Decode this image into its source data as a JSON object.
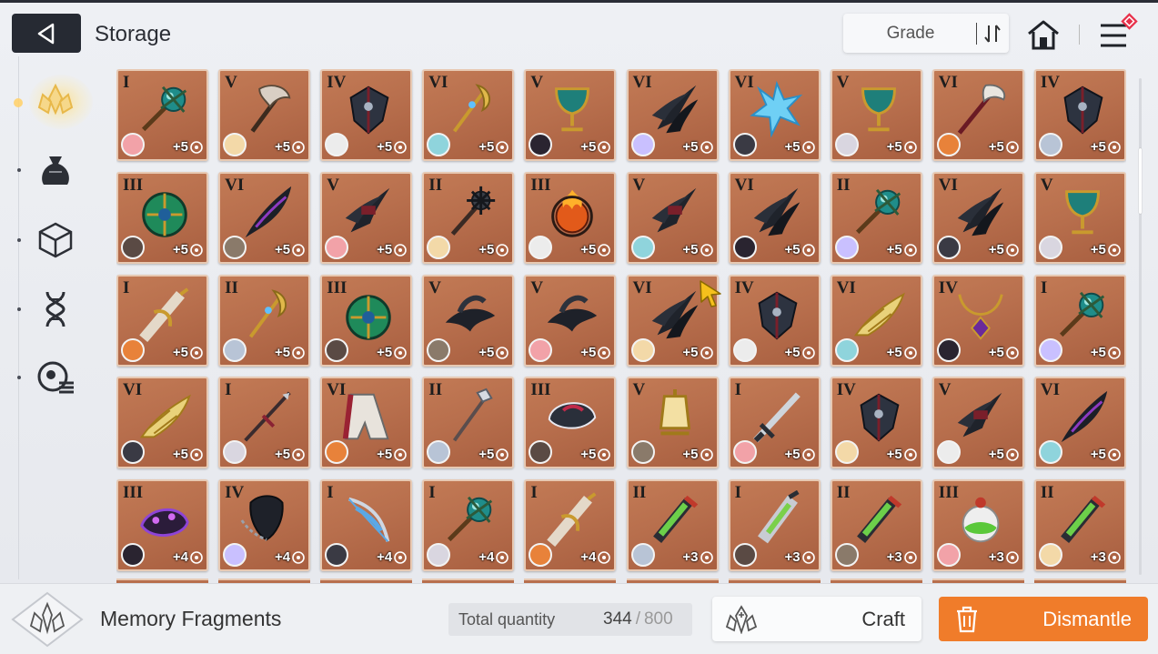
{
  "header": {
    "title": "Storage",
    "sort_label": "Grade"
  },
  "sidebar": {
    "items": [
      {
        "icon": "memory-fragment-icon",
        "active": true
      },
      {
        "icon": "pouch-icon",
        "active": false
      },
      {
        "icon": "cube-icon",
        "active": false
      },
      {
        "icon": "dna-icon",
        "active": false
      },
      {
        "icon": "badge-list-icon",
        "active": false
      }
    ]
  },
  "colors": {
    "accent": "#f07c2a",
    "cell_bg": "#b86f4d",
    "cell_border": "#e7c9b3",
    "dark_button": "#262a33"
  },
  "items": [
    {
      "grade": "I",
      "plus": "+5",
      "art": "scepter-orb"
    },
    {
      "grade": "V",
      "plus": "+5",
      "art": "hammer-axe"
    },
    {
      "grade": "IV",
      "plus": "+5",
      "art": "dark-shield"
    },
    {
      "grade": "VI",
      "plus": "+5",
      "art": "golden-wand"
    },
    {
      "grade": "V",
      "plus": "+5",
      "art": "golden-goblet"
    },
    {
      "grade": "VI",
      "plus": "+5",
      "art": "dark-claw"
    },
    {
      "grade": "VI",
      "plus": "+5",
      "art": "ice-crystal"
    },
    {
      "grade": "V",
      "plus": "+5",
      "art": "golden-goblet"
    },
    {
      "grade": "VI",
      "plus": "+5",
      "art": "feather-brush"
    },
    {
      "grade": "IV",
      "plus": "+5",
      "art": "dark-shield"
    },
    {
      "grade": "III",
      "plus": "+5",
      "art": "jade-orb"
    },
    {
      "grade": "VI",
      "plus": "+5",
      "art": "dark-feather"
    },
    {
      "grade": "V",
      "plus": "+5",
      "art": "dark-claw-red"
    },
    {
      "grade": "II",
      "plus": "+5",
      "art": "spiked-mace"
    },
    {
      "grade": "III",
      "plus": "+5",
      "art": "flame-orb"
    },
    {
      "grade": "V",
      "plus": "+5",
      "art": "dark-claw-red"
    },
    {
      "grade": "VI",
      "plus": "+5",
      "art": "dark-claw"
    },
    {
      "grade": "II",
      "plus": "+5",
      "art": "scepter-orb"
    },
    {
      "grade": "VI",
      "plus": "+5",
      "art": "dark-claw"
    },
    {
      "grade": "V",
      "plus": "+5",
      "art": "golden-goblet"
    },
    {
      "grade": "I",
      "plus": "+5",
      "art": "golden-blade"
    },
    {
      "grade": "II",
      "plus": "+5",
      "art": "golden-wand"
    },
    {
      "grade": "III",
      "plus": "+5",
      "art": "jade-orb"
    },
    {
      "grade": "V",
      "plus": "+5",
      "art": "raven-hat"
    },
    {
      "grade": "V",
      "plus": "+5",
      "art": "raven-hat"
    },
    {
      "grade": "VI",
      "plus": "+5",
      "art": "dark-claw"
    },
    {
      "grade": "IV",
      "plus": "+5",
      "art": "dark-shield"
    },
    {
      "grade": "VI",
      "plus": "+5",
      "art": "golden-wing"
    },
    {
      "grade": "IV",
      "plus": "+5",
      "art": "gem-necklace"
    },
    {
      "grade": "I",
      "plus": "+5",
      "art": "scepter-orb"
    },
    {
      "grade": "VI",
      "plus": "+5",
      "art": "golden-wing"
    },
    {
      "grade": "I",
      "plus": "+5",
      "art": "thin-spear"
    },
    {
      "grade": "VI",
      "plus": "+5",
      "art": "red-cape"
    },
    {
      "grade": "II",
      "plus": "+5",
      "art": "silver-staff"
    },
    {
      "grade": "III",
      "plus": "+5",
      "art": "dark-helm"
    },
    {
      "grade": "V",
      "plus": "+5",
      "art": "golden-lantern"
    },
    {
      "grade": "I",
      "plus": "+5",
      "art": "silver-sword"
    },
    {
      "grade": "IV",
      "plus": "+5",
      "art": "dark-shield"
    },
    {
      "grade": "V",
      "plus": "+5",
      "art": "dark-claw-red"
    },
    {
      "grade": "VI",
      "plus": "+5",
      "art": "dark-feather"
    },
    {
      "grade": "III",
      "plus": "+4",
      "art": "purple-beast"
    },
    {
      "grade": "IV",
      "plus": "+4",
      "art": "chain-mask"
    },
    {
      "grade": "I",
      "plus": "+4",
      "art": "blue-bow"
    },
    {
      "grade": "I",
      "plus": "+4",
      "art": "scepter-orb"
    },
    {
      "grade": "I",
      "plus": "+4",
      "art": "golden-blade"
    },
    {
      "grade": "II",
      "plus": "+3",
      "art": "green-vial"
    },
    {
      "grade": "I",
      "plus": "+3",
      "art": "green-blade"
    },
    {
      "grade": "II",
      "plus": "+3",
      "art": "green-vial"
    },
    {
      "grade": "III",
      "plus": "+3",
      "art": "green-flask"
    },
    {
      "grade": "II",
      "plus": "+3",
      "art": "green-vial"
    }
  ],
  "footer": {
    "category_label": "Memory Fragments",
    "total_label": "Total quantity",
    "total_value": "344",
    "total_sep": "/",
    "total_max": "800",
    "craft_label": "Craft",
    "dismantle_label": "Dismantle"
  }
}
